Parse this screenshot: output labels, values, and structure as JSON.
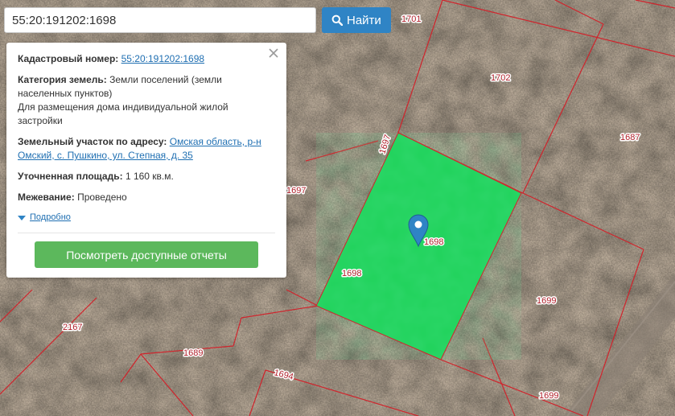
{
  "search": {
    "value": "55:20:191202:1698",
    "button_label": "Найти",
    "button_icon": "search-icon"
  },
  "info_card": {
    "cadastral_label": "Кадастровый номер:",
    "cadastral_value": "55:20:191202:1698",
    "category_label": "Категория земель:",
    "category_value_1": "Земли поселений (земли",
    "category_value_2": "населенных пунктов)",
    "usage_1": "Для размещения дома индивидуальной жилой",
    "usage_2": "застройки",
    "address_label": "Земельный участок по адресу:",
    "address_value_1": "Омская область, р-н",
    "address_value_2": "Омский, с. Пушкино, ул. Степная, д. 35",
    "area_label": "Уточненная площадь:",
    "area_value": "1 160 кв.м.",
    "survey_label": "Межевание:",
    "survey_value": "Проведено",
    "details_label": "Подробно",
    "report_button": "Посмотреть доступные отчеты",
    "close_icon": "close-icon"
  },
  "map": {
    "parcel_labels": [
      "1701",
      "1702",
      "1697",
      "1697",
      "1687",
      "1698",
      "1698",
      "1699",
      "2167",
      "1689",
      "1694",
      "1699"
    ],
    "selected_parcel_color": "#1fd25a",
    "boundary_color": "#d0242c",
    "marker_color": "#2f84c5"
  },
  "colors": {
    "primary": "#2f84c5",
    "success": "#5cb85c",
    "link": "#1f6fb2"
  }
}
